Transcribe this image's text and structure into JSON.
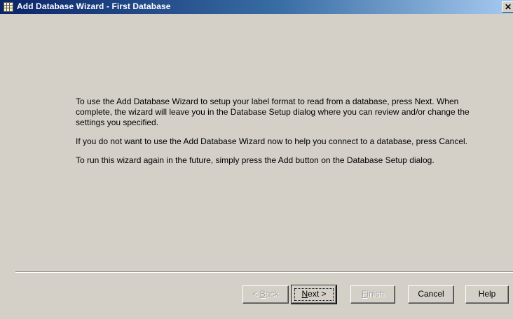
{
  "window": {
    "title": "Add Database Wizard - First Database",
    "close_glyph": "✕"
  },
  "content": {
    "paragraph_1": "To use the Add Database Wizard to setup your label format to read from a database, press Next.  When complete, the wizard will leave you in the Database Setup dialog where you can review and/or change the settings you specified.",
    "paragraph_2": "If you do not want to use the Add Database Wizard now to help you connect to a database, press Cancel.",
    "paragraph_3": "To run this wizard again in the future, simply press the Add button on the Database Setup dialog."
  },
  "buttons": {
    "back": {
      "prefix": "< ",
      "mnemonic": "B",
      "rest": "ack",
      "enabled": false
    },
    "next": {
      "mnemonic": "N",
      "rest": "ext >",
      "enabled": true,
      "default": true
    },
    "finish": {
      "mnemonic": "F",
      "rest": "inish",
      "enabled": false
    },
    "cancel": "Cancel",
    "help": "Help"
  },
  "colors": {
    "dialog_bg": "#d4d0c8",
    "title_gradient_start": "#0a246a",
    "title_gradient_end": "#a6caf0",
    "disabled_text": "#a0a0a0"
  },
  "icons": {
    "title_icon": "database-grid-icon",
    "close": "close-icon"
  }
}
